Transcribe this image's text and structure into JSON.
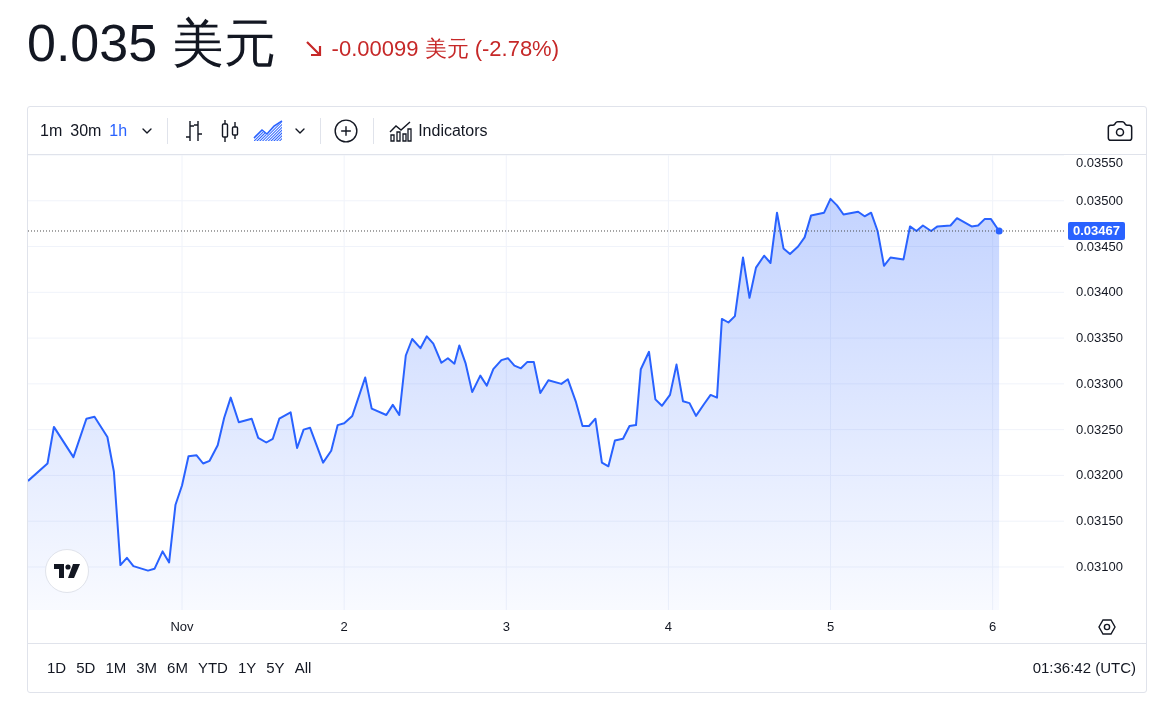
{
  "price": {
    "value": "0.035 美元",
    "change": "-0.00099 美元 (-2.78%)"
  },
  "toolbar": {
    "intervals": [
      {
        "label": "1m",
        "selected": false
      },
      {
        "label": "30m",
        "selected": false
      },
      {
        "label": "1h",
        "selected": true
      }
    ],
    "chart_types": [
      {
        "kind": "bars",
        "selected": false
      },
      {
        "kind": "candles",
        "selected": false
      },
      {
        "kind": "area",
        "selected": true
      }
    ],
    "indicators_button": "Indicators"
  },
  "chart": {
    "chart_data": {
      "type": "area",
      "grid": true,
      "ref_lines": [
        {
          "axis": "y",
          "value": 0.03467,
          "label": "0.03467"
        }
      ],
      "xlim": [
        0.05,
        6.44
      ],
      "ylim": [
        0.03053,
        0.0355
      ],
      "xticks": [
        {
          "value": 1,
          "label": "Nov"
        },
        2,
        3,
        4,
        5,
        6
      ],
      "yticks": [
        {
          "value": 0.031,
          "label": "0.03100"
        },
        {
          "value": 0.0315,
          "label": "0.03150"
        },
        {
          "value": 0.032,
          "label": "0.03200"
        },
        {
          "value": 0.0325,
          "label": "0.03250"
        },
        {
          "value": 0.033,
          "label": "0.03300"
        },
        {
          "value": 0.0335,
          "label": "0.03350"
        },
        {
          "value": 0.034,
          "label": "0.03400"
        },
        {
          "value": 0.0345,
          "label": "0.03450"
        },
        {
          "value": 0.035,
          "label": "0.03500"
        },
        {
          "value": 0.0355,
          "label": "0.03550"
        }
      ],
      "x": [
        0.05,
        0.17,
        0.21,
        0.33,
        0.41,
        0.46,
        0.54,
        0.58,
        0.62,
        0.66,
        0.7,
        0.79,
        0.83,
        0.88,
        0.92,
        0.96,
        1,
        1.04,
        1.09,
        1.13,
        1.17,
        1.22,
        1.26,
        1.3,
        1.35,
        1.43,
        1.47,
        1.52,
        1.56,
        1.6,
        1.67,
        1.71,
        1.75,
        1.79,
        1.87,
        1.92,
        1.96,
        2.0,
        2.05,
        2.13,
        2.17,
        2.26,
        2.3,
        2.34,
        2.38,
        2.42,
        2.47,
        2.51,
        2.55,
        2.6,
        2.64,
        2.68,
        2.71,
        2.75,
        2.79,
        2.84,
        2.88,
        2.92,
        2.97,
        3.01,
        3.05,
        3.09,
        3.13,
        3.17,
        3.21,
        3.26,
        3.34,
        3.38,
        3.43,
        3.47,
        3.51,
        3.55,
        3.59,
        3.63,
        3.67,
        3.72,
        3.76,
        3.8,
        3.83,
        3.88,
        3.92,
        3.96,
        4.01,
        4.05,
        4.09,
        4.13,
        4.17,
        4.22,
        4.26,
        4.3,
        4.33,
        4.37,
        4.41,
        4.46,
        4.5,
        4.54,
        4.59,
        4.63,
        4.67,
        4.71,
        4.75,
        4.8,
        4.84,
        4.88,
        4.96,
        5.0,
        5.04,
        5.08,
        5.17,
        5.21,
        5.25,
        5.29,
        5.33,
        5.37,
        5.45,
        5.49,
        5.53,
        5.57,
        5.62,
        5.66,
        5.74,
        5.78,
        5.87,
        5.91,
        5.95,
        5.99,
        6.04
      ],
      "series": [
        {
          "color": "#2962ff",
          "values": [
            0.03194,
            0.03213,
            0.03253,
            0.0322,
            0.03262,
            0.03264,
            0.03242,
            0.03204,
            0.03102,
            0.0311,
            0.03101,
            0.03096,
            0.03098,
            0.03117,
            0.03105,
            0.03168,
            0.03189,
            0.03221,
            0.03222,
            0.03213,
            0.03216,
            0.03233,
            0.03263,
            0.03285,
            0.03258,
            0.03262,
            0.03241,
            0.03236,
            0.0324,
            0.03262,
            0.03269,
            0.0323,
            0.0325,
            0.03252,
            0.03214,
            0.03227,
            0.03255,
            0.03257,
            0.03265,
            0.03307,
            0.03273,
            0.03266,
            0.03277,
            0.03266,
            0.03331,
            0.03349,
            0.03339,
            0.03352,
            0.03344,
            0.03323,
            0.03328,
            0.03322,
            0.03342,
            0.03322,
            0.03291,
            0.03309,
            0.03298,
            0.03316,
            0.03326,
            0.03328,
            0.0332,
            0.03317,
            0.03324,
            0.03324,
            0.0329,
            0.03304,
            0.033,
            0.03305,
            0.0328,
            0.03254,
            0.03254,
            0.03262,
            0.03214,
            0.0321,
            0.03238,
            0.0324,
            0.03254,
            0.03255,
            0.03316,
            0.03335,
            0.03283,
            0.03276,
            0.03288,
            0.03321,
            0.03281,
            0.03279,
            0.03265,
            0.03278,
            0.03288,
            0.03285,
            0.03371,
            0.03367,
            0.03374,
            0.03438,
            0.03394,
            0.03427,
            0.0344,
            0.03432,
            0.03487,
            0.03448,
            0.03442,
            0.0345,
            0.0346,
            0.03484,
            0.03487,
            0.03502,
            0.03495,
            0.03485,
            0.03488,
            0.03483,
            0.03487,
            0.03467,
            0.03429,
            0.03438,
            0.03436,
            0.03472,
            0.03467,
            0.03473,
            0.03467,
            0.03472,
            0.03473,
            0.03481,
            0.03472,
            0.03473,
            0.0348,
            0.0348,
            0.03467
          ]
        }
      ]
    }
  },
  "ranges": [
    "1D",
    "5D",
    "1M",
    "3M",
    "6M",
    "YTD",
    "1Y",
    "5Y",
    "All"
  ],
  "clock": "01:36:42 (UTC)"
}
